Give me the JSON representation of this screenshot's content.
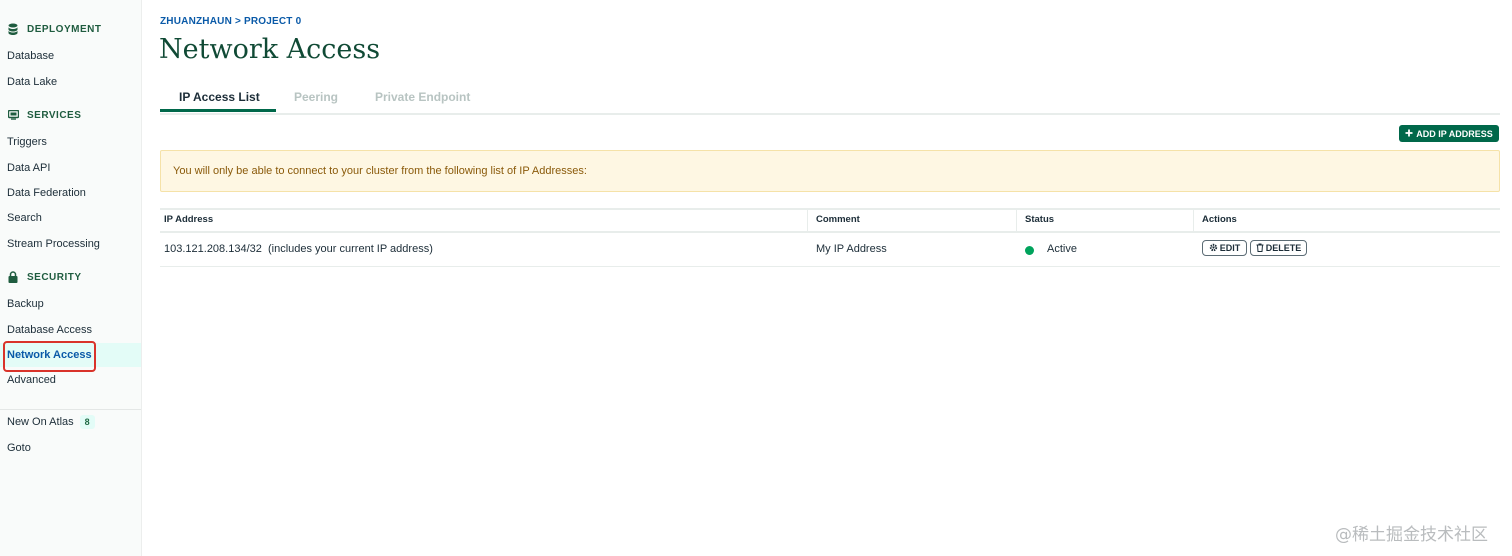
{
  "sidebar": {
    "sections": [
      {
        "title": "DEPLOYMENT",
        "icon": "database-stack-icon",
        "items": [
          "Database",
          "Data Lake"
        ]
      },
      {
        "title": "SERVICES",
        "icon": "services-icon",
        "items": [
          "Triggers",
          "Data API",
          "Data Federation",
          "Search",
          "Stream Processing"
        ]
      },
      {
        "title": "SECURITY",
        "icon": "lock-icon",
        "items": [
          "Backup",
          "Database Access",
          "Network Access",
          "Advanced"
        ]
      }
    ],
    "active_item": "Network Access",
    "footer": {
      "new_on_atlas": "New On Atlas",
      "new_on_atlas_count": "8",
      "goto": "Goto"
    }
  },
  "breadcrumb": "ZHUANZHAUN > PROJECT 0",
  "page_title": "Network Access",
  "tabs": [
    "IP Access List",
    "Peering",
    "Private Endpoint"
  ],
  "active_tab": "IP Access List",
  "add_button": "ADD IP ADDRESS",
  "banner": "You will only be able to connect to your cluster from the following list of IP Addresses:",
  "table": {
    "headers": [
      "IP Address",
      "Comment",
      "Status",
      "Actions"
    ],
    "rows": [
      {
        "ip": "103.121.208.134/32  (includes your current IP address)",
        "comment": "My IP Address",
        "status": "Active",
        "edit": "EDIT",
        "delete": "DELETE"
      }
    ]
  },
  "colors": {
    "brand_green": "#00684a",
    "link_blue": "#0a5aa8",
    "active_status": "#00a35c",
    "banner_bg": "#fef7e3"
  },
  "watermark": "@稀土掘金技术社区"
}
